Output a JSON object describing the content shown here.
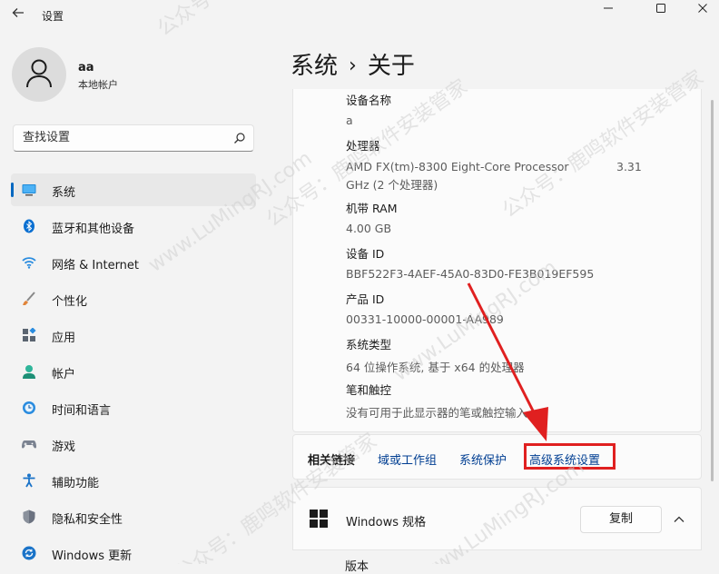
{
  "window": {
    "title": "设置",
    "back_icon": "back-arrow-icon",
    "controls": [
      "minimize-icon",
      "maximize-icon",
      "close-icon"
    ]
  },
  "user": {
    "name": "aa",
    "account_type": "本地帐户"
  },
  "search": {
    "placeholder": "查找设置",
    "value": ""
  },
  "nav": {
    "items": [
      {
        "label": "系统",
        "icon": "monitor-icon",
        "active": true
      },
      {
        "label": "蓝牙和其他设备",
        "icon": "bluetooth-icon"
      },
      {
        "label": "网络 & Internet",
        "icon": "wifi-icon"
      },
      {
        "label": "个性化",
        "icon": "brush-icon"
      },
      {
        "label": "应用",
        "icon": "apps-icon"
      },
      {
        "label": "帐户",
        "icon": "person-icon"
      },
      {
        "label": "时间和语言",
        "icon": "clock-globe-icon"
      },
      {
        "label": "游戏",
        "icon": "gamepad-icon"
      },
      {
        "label": "辅助功能",
        "icon": "accessibility-icon"
      },
      {
        "label": "隐私和安全性",
        "icon": "shield-icon"
      },
      {
        "label": "Windows 更新",
        "icon": "update-icon"
      }
    ]
  },
  "breadcrumb": {
    "parent": "系统",
    "separator": "›",
    "current": "关于"
  },
  "device_specs": {
    "device_name_label": "设备名称",
    "device_name": "a",
    "processor_label": "处理器",
    "processor_line1": "AMD FX(tm)-8300 Eight-Core Processor",
    "processor_speed": "3.31",
    "processor_line2": "GHz  (2 个处理器)",
    "ram_label": "机带 RAM",
    "ram": "4.00 GB",
    "device_id_label": "设备 ID",
    "device_id": "BBF522F3-4AEF-45A0-83D0-FE3B019EF595",
    "product_id_label": "产品 ID",
    "product_id": "00331-10000-00001-AA989",
    "system_type_label": "系统类型",
    "system_type": "64 位操作系统, 基于 x64 的处理器",
    "pen_touch_label": "笔和触控",
    "pen_touch": "没有可用于此显示器的笔或触控输入"
  },
  "related": {
    "title": "相关链接",
    "links": [
      "域或工作组",
      "系统保护",
      "高级系统设置"
    ],
    "highlight_color": "#e02020"
  },
  "windows_spec": {
    "title": "Windows 规格",
    "copy_label": "复制",
    "next_row_label": "版本"
  },
  "accent_color": "#0067c0",
  "watermark": {
    "lines": [
      "公众号：鹿鸣软件安装管家",
      "www.LuMingRJ.com"
    ],
    "color": "#c8c8c8"
  }
}
